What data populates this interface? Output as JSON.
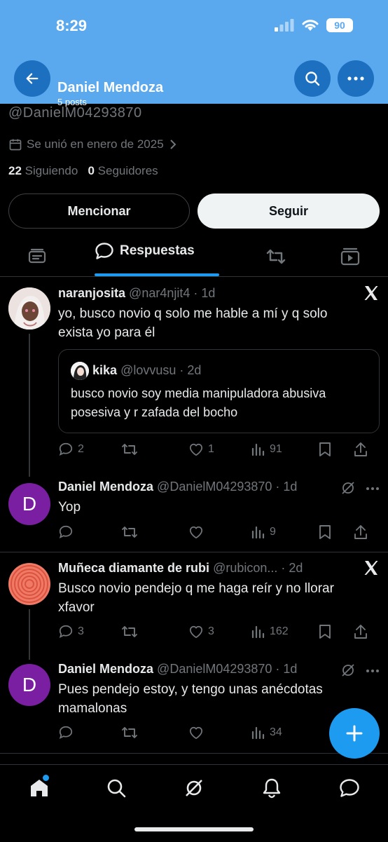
{
  "status_bar": {
    "time": "8:29",
    "battery": "90"
  },
  "header": {
    "name": "Daniel Mendoza",
    "posts": "5 posts"
  },
  "profile": {
    "handle": "@DanielM04293870",
    "joined": "Se unió en enero de 2025",
    "following_count": "22",
    "following_label": "Siguiendo",
    "followers_count": "0",
    "followers_label": "Seguidores",
    "mention_label": "Mencionar",
    "follow_label": "Seguir"
  },
  "tabs": {
    "active_label": "Respuestas"
  },
  "posts": [
    {
      "name": "naranjosita",
      "meta": "@nar4njit4 · 1d",
      "text_lines": [
        "yo, busco novio q solo me hable a mí y q solo",
        "exista yo para él"
      ],
      "quote": {
        "name": "kika",
        "meta": "@lovvusu · 2d",
        "text_lines": [
          "busco novio soy media manipuladora abusiva",
          "posesiva y r zafada del bocho"
        ]
      },
      "replies": "2",
      "reposts": "",
      "likes": "1",
      "views": "91"
    },
    {
      "name": "Daniel Mendoza",
      "meta": "@DanielM04293870 · 1d",
      "avatar_letter": "D",
      "text_lines": [
        "Yop"
      ],
      "replies": "",
      "reposts": "",
      "likes": "",
      "views": "9"
    },
    {
      "name": "Muñeca diamante de rubi",
      "meta": "@rubicon... · 2d",
      "text_lines": [
        "Busco novio pendejo q me haga reír y no llorar",
        "xfavor"
      ],
      "replies": "3",
      "reposts": "",
      "likes": "3",
      "views": "162"
    },
    {
      "name": "Daniel Mendoza",
      "meta": "@DanielM04293870 · 1d",
      "avatar_letter": "D",
      "text_lines": [
        "Pues pendejo estoy, y tengo unas anécdotas",
        "mamalonas"
      ],
      "replies": "",
      "reposts": "",
      "likes": "",
      "views": "34"
    }
  ],
  "colors": {
    "accent": "#1d9bf0",
    "header_bg": "#5aa8ee",
    "avatar_purple": "#7b1fa2"
  }
}
